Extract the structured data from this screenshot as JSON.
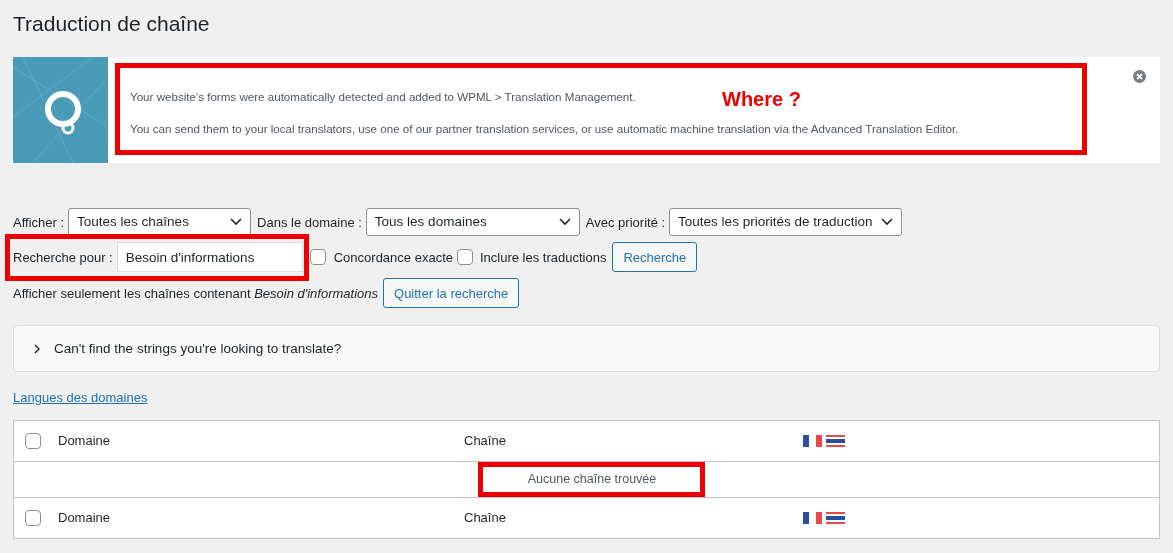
{
  "page_title": "Traduction de chaîne",
  "notice": {
    "lines": [
      "Your website's forms were automatically detected and added to WPML > Translation Management.",
      "You can send them to your local translators, use one of our partner translation services, or use automatic machine translation via the Advanced Translation Editor."
    ]
  },
  "filters": [
    {
      "label": "Afficher :",
      "value": "Toutes les chaînes"
    },
    {
      "label": "Dans le domaine :",
      "value": "Tous les domaines"
    },
    {
      "label": "Avec priorité :",
      "value": "Toutes les priorités de traduction"
    }
  ],
  "search": {
    "label": "Recherche pour :",
    "value": "Besoin d'informations",
    "options": [
      {
        "label": "Concordance exacte",
        "checked": false
      },
      {
        "label": "Inclure les traductions",
        "checked": false
      }
    ],
    "button": "Recherche"
  },
  "search_info": {
    "text": "Afficher seulement les chaînes contenant *Besoin d'informations*",
    "button": "Quitter la recherche"
  },
  "help_box": {
    "text": "Can't find the strings you're looking to translate?",
    "expanded": false
  },
  "domain_languages_link": "Langues des domaines",
  "table": {
    "header_columns": [
      "Domaine",
      "Chaîne"
    ],
    "header_flags": [
      {
        "kind": "fr"
      },
      {
        "kind": "th"
      }
    ],
    "footer_columns": [
      "Domaine",
      "Chaîne"
    ],
    "footer_flags": [
      {
        "kind": "fr"
      },
      {
        "kind": "th"
      }
    ],
    "header_checked": false,
    "footer_checked": false,
    "empty_message": "Aucune chaîne trouvée"
  },
  "annotations": [
    {
      "text": "Where ?"
    }
  ]
}
